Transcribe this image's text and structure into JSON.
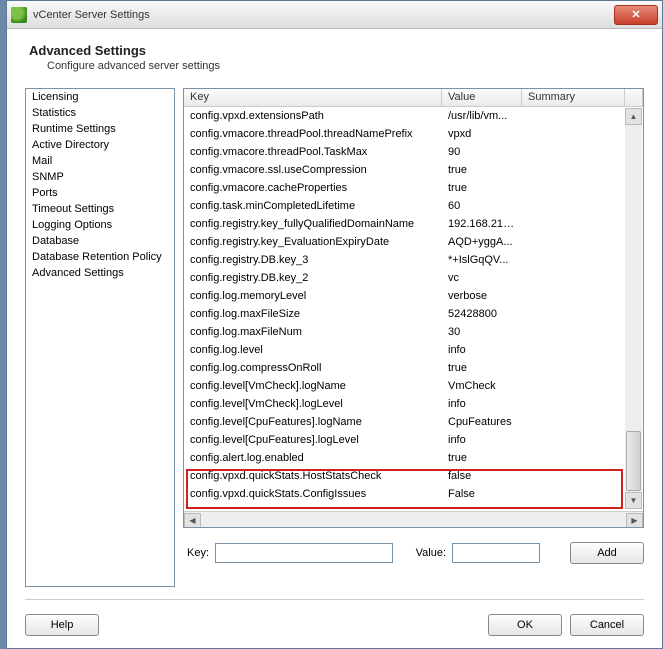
{
  "window": {
    "title": "vCenter Server Settings"
  },
  "header": {
    "title": "Advanced Settings",
    "subtitle": "Configure advanced server settings"
  },
  "sidebar": {
    "items": [
      {
        "label": "Licensing"
      },
      {
        "label": "Statistics"
      },
      {
        "label": "Runtime Settings"
      },
      {
        "label": "Active Directory"
      },
      {
        "label": "Mail"
      },
      {
        "label": "SNMP"
      },
      {
        "label": "Ports"
      },
      {
        "label": "Timeout Settings"
      },
      {
        "label": "Logging Options"
      },
      {
        "label": "Database"
      },
      {
        "label": "Database Retention Policy"
      },
      {
        "label": "Advanced Settings"
      }
    ]
  },
  "grid": {
    "columns": {
      "key": "Key",
      "value": "Value",
      "summary": "Summary"
    },
    "rows": [
      {
        "key": "config.vpxd.extensionsPath",
        "value": "/usr/lib/vm...",
        "summary": ""
      },
      {
        "key": "config.vmacore.threadPool.threadNamePrefix",
        "value": "vpxd",
        "summary": ""
      },
      {
        "key": "config.vmacore.threadPool.TaskMax",
        "value": "90",
        "summary": ""
      },
      {
        "key": "config.vmacore.ssl.useCompression",
        "value": "true",
        "summary": ""
      },
      {
        "key": "config.vmacore.cacheProperties",
        "value": "true",
        "summary": ""
      },
      {
        "key": "config.task.minCompletedLifetime",
        "value": "60",
        "summary": ""
      },
      {
        "key": "config.registry.key_fullyQualifiedDomainName",
        "value": "192.168.216...",
        "summary": ""
      },
      {
        "key": "config.registry.key_EvaluationExpiryDate",
        "value": "AQD+yggA...",
        "summary": ""
      },
      {
        "key": "config.registry.DB.key_3",
        "value": "*+IslGqQV...",
        "summary": ""
      },
      {
        "key": "config.registry.DB.key_2",
        "value": "vc",
        "summary": ""
      },
      {
        "key": "config.log.memoryLevel",
        "value": "verbose",
        "summary": ""
      },
      {
        "key": "config.log.maxFileSize",
        "value": "52428800",
        "summary": ""
      },
      {
        "key": "config.log.maxFileNum",
        "value": "30",
        "summary": ""
      },
      {
        "key": "config.log.level",
        "value": "info",
        "summary": ""
      },
      {
        "key": "config.log.compressOnRoll",
        "value": "true",
        "summary": ""
      },
      {
        "key": "config.level[VmCheck].logName",
        "value": "VmCheck",
        "summary": ""
      },
      {
        "key": "config.level[VmCheck].logLevel",
        "value": "info",
        "summary": ""
      },
      {
        "key": "config.level[CpuFeatures].logName",
        "value": "CpuFeatures",
        "summary": ""
      },
      {
        "key": "config.level[CpuFeatures].logLevel",
        "value": "info",
        "summary": ""
      },
      {
        "key": "config.alert.log.enabled",
        "value": "true",
        "summary": ""
      },
      {
        "key": "config.vpxd.quickStats.HostStatsCheck",
        "value": "false",
        "summary": ""
      },
      {
        "key": "config.vpxd.quickStats.ConfigIssues",
        "value": "False",
        "summary": ""
      }
    ]
  },
  "inputRow": {
    "keyLabel": "Key:",
    "valueLabel": "Value:",
    "keyValue": "",
    "valueValue": "",
    "addLabel": "Add"
  },
  "footer": {
    "help": "Help",
    "ok": "OK",
    "cancel": "Cancel"
  }
}
